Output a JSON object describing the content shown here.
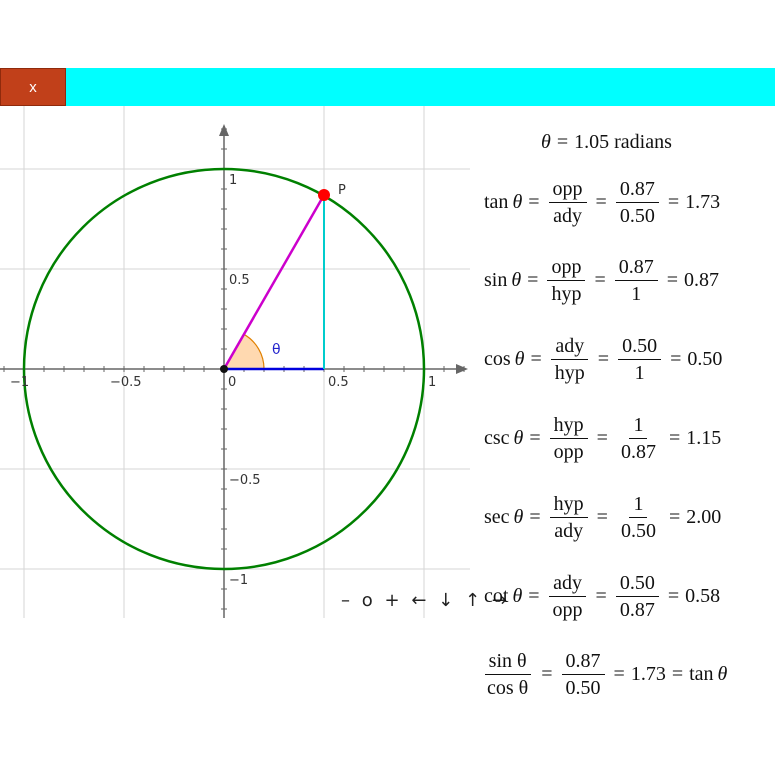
{
  "close_button": {
    "label": "x"
  },
  "graph": {
    "x_ticks": [
      "−1",
      "−0.5",
      "0",
      "0.5",
      "1"
    ],
    "y_ticks": [
      "1",
      "0.5",
      "−0.5",
      "−1"
    ],
    "point_label": "P",
    "angle_label": "θ",
    "angle_radians": 1.05,
    "point": {
      "x": 0.5,
      "y": 0.87
    },
    "colors": {
      "circle": "#008000",
      "hypotenuse": "#cc00cc",
      "opposite": "#00cccc",
      "adjacent": "#0000dd",
      "angle_fill": "#ffd9b0",
      "angle_stroke": "#e08000",
      "point": "#ff0000",
      "grid": "#d6d6d6",
      "axes": "#666666"
    }
  },
  "controls": {
    "zoom_out": "–",
    "reset": "o",
    "zoom_in": "+",
    "left": "←",
    "down": "↓",
    "up": "↑",
    "right": "→"
  },
  "formulas": {
    "title": {
      "theta": "θ",
      "equals": "=",
      "value": "1.05 radians"
    },
    "tan": {
      "fn": "tan",
      "var": "θ",
      "num1": "opp",
      "den1": "ady",
      "num2": "0.87",
      "den2": "0.50",
      "result": "1.73"
    },
    "sin": {
      "fn": "sin",
      "var": "θ",
      "num1": "opp",
      "den1": "hyp",
      "num2": "0.87",
      "den2": "1",
      "result": "0.87"
    },
    "cos": {
      "fn": "cos",
      "var": "θ",
      "num1": "ady",
      "den1": "hyp",
      "num2": "0.50",
      "den2": "1",
      "result": "0.50"
    },
    "csc": {
      "fn": "csc",
      "var": "θ",
      "num1": "hyp",
      "den1": "opp",
      "num2": "1",
      "den2": "0.87",
      "result": "1.15"
    },
    "sec": {
      "fn": "sec",
      "var": "θ",
      "num1": "hyp",
      "den1": "ady",
      "num2": "1",
      "den2": "0.50",
      "result": "2.00"
    },
    "cot": {
      "fn": "cot",
      "var": "θ",
      "num1": "ady",
      "den1": "opp",
      "num2": "0.50",
      "den2": "0.87",
      "result": "0.58"
    },
    "identity": {
      "num1": "sin θ",
      "den1": "cos θ",
      "num2": "0.87",
      "den2": "0.50",
      "result": "1.73",
      "tail": "tan",
      "tail_var": "θ"
    }
  }
}
